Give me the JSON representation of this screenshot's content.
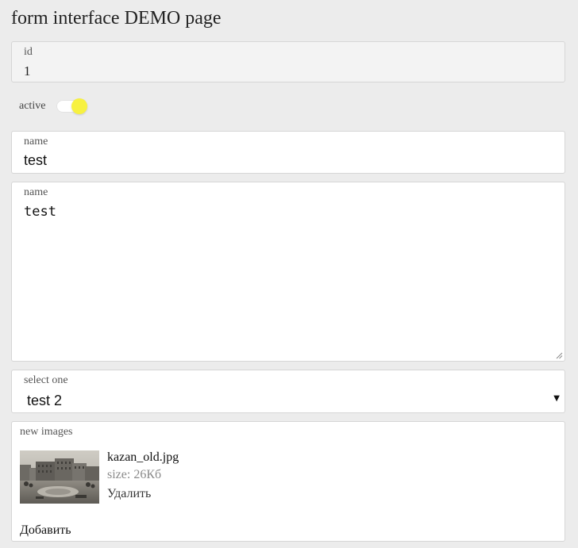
{
  "page": {
    "title": "form interface DEMO page"
  },
  "fields": {
    "id": {
      "label": "id",
      "value": "1"
    },
    "active": {
      "label": "active",
      "value": true,
      "knob_color": "#f7f141"
    },
    "name_input": {
      "label": "name",
      "value": "test"
    },
    "name_textarea": {
      "label": "name",
      "value": "test"
    },
    "select": {
      "label": "select one",
      "selected": "test 2",
      "arrow_icon": "caret-down-icon"
    },
    "images": {
      "label": "new images",
      "files": [
        {
          "name": "kazan_old.jpg",
          "size": "size: 26Кб",
          "delete_label": "Удалить",
          "thumbnail_icon": "photo-thumbnail"
        }
      ],
      "add_label": "Добавить"
    }
  },
  "colors": {
    "background": "#ececec",
    "field_bg": "#ffffff",
    "readonly_bg": "#f3f3f3",
    "border": "#d6d6d6"
  }
}
